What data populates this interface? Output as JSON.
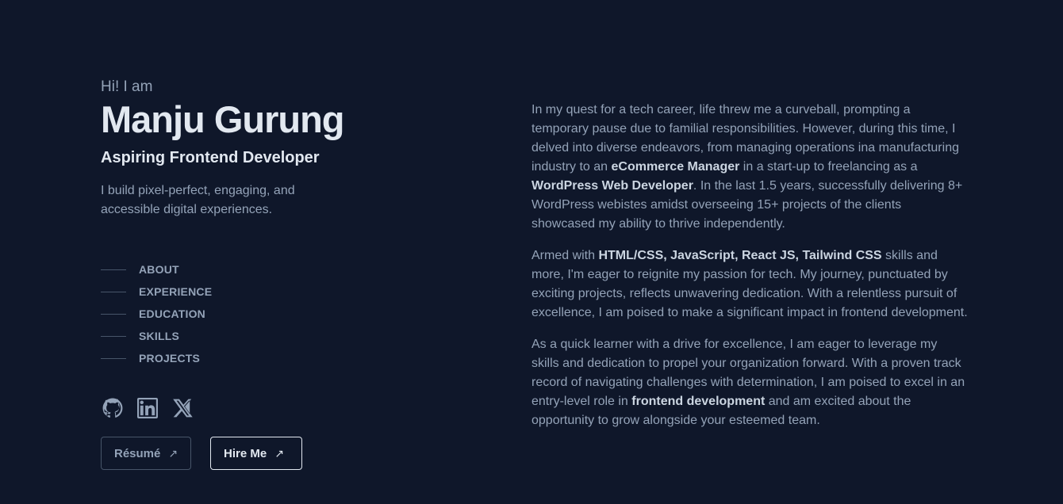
{
  "hero": {
    "greeting": "Hi! I am",
    "name": "Manju Gurung",
    "role": "Aspiring Frontend Developer",
    "tagline": "I build pixel-perfect, engaging, and accessible digital experiences."
  },
  "nav": {
    "items": [
      {
        "label": "ABOUT"
      },
      {
        "label": "EXPERIENCE"
      },
      {
        "label": "EDUCATION"
      },
      {
        "label": "SKILLS"
      },
      {
        "label": "PROJECTS"
      }
    ]
  },
  "social": {
    "icons": [
      "github-icon",
      "linkedin-icon",
      "x-twitter-icon"
    ]
  },
  "buttons": {
    "resume_label": "Résumé",
    "hire_label": "Hire Me",
    "arrow": "↗"
  },
  "about": {
    "p1": {
      "a": "In my quest for a tech career, life threw me a curveball, prompting a temporary pause due to familial responsibilities. However, during this time, I delved into diverse endeavors, from managing operations ina manufacturing industry to an ",
      "b": "eCommerce Manager",
      "c": " in a start-up to freelancing as a ",
      "d": "WordPress Web Developer",
      "e": ". In the last 1.5 years, successfully delivering 8+ WordPress webistes amidst overseeing 15+ projects of the clients showcased my ability to thrive independently."
    },
    "p2": {
      "a": "Armed with ",
      "b": "HTML/CSS, JavaScript, React JS, Tailwind CSS",
      "c": " skills and more, I'm eager to reignite my passion for tech. My journey, punctuated by exciting projects, reflects unwavering dedication. With a relentless pursuit of excellence, I am poised to make a significant impact in frontend development."
    },
    "p3": {
      "a": "As a quick learner with a drive for excellence, I am eager to leverage my skills and dedication to propel your organization forward. With a proven track record of navigating challenges with determination, I am poised to excel in an entry-level role in ",
      "b": "frontend development",
      "c": " and am excited about the opportunity to grow alongside your esteemed team."
    }
  },
  "colors": {
    "background": "#0f172a",
    "heading": "#e2e8f0",
    "text": "#94a3b8"
  }
}
